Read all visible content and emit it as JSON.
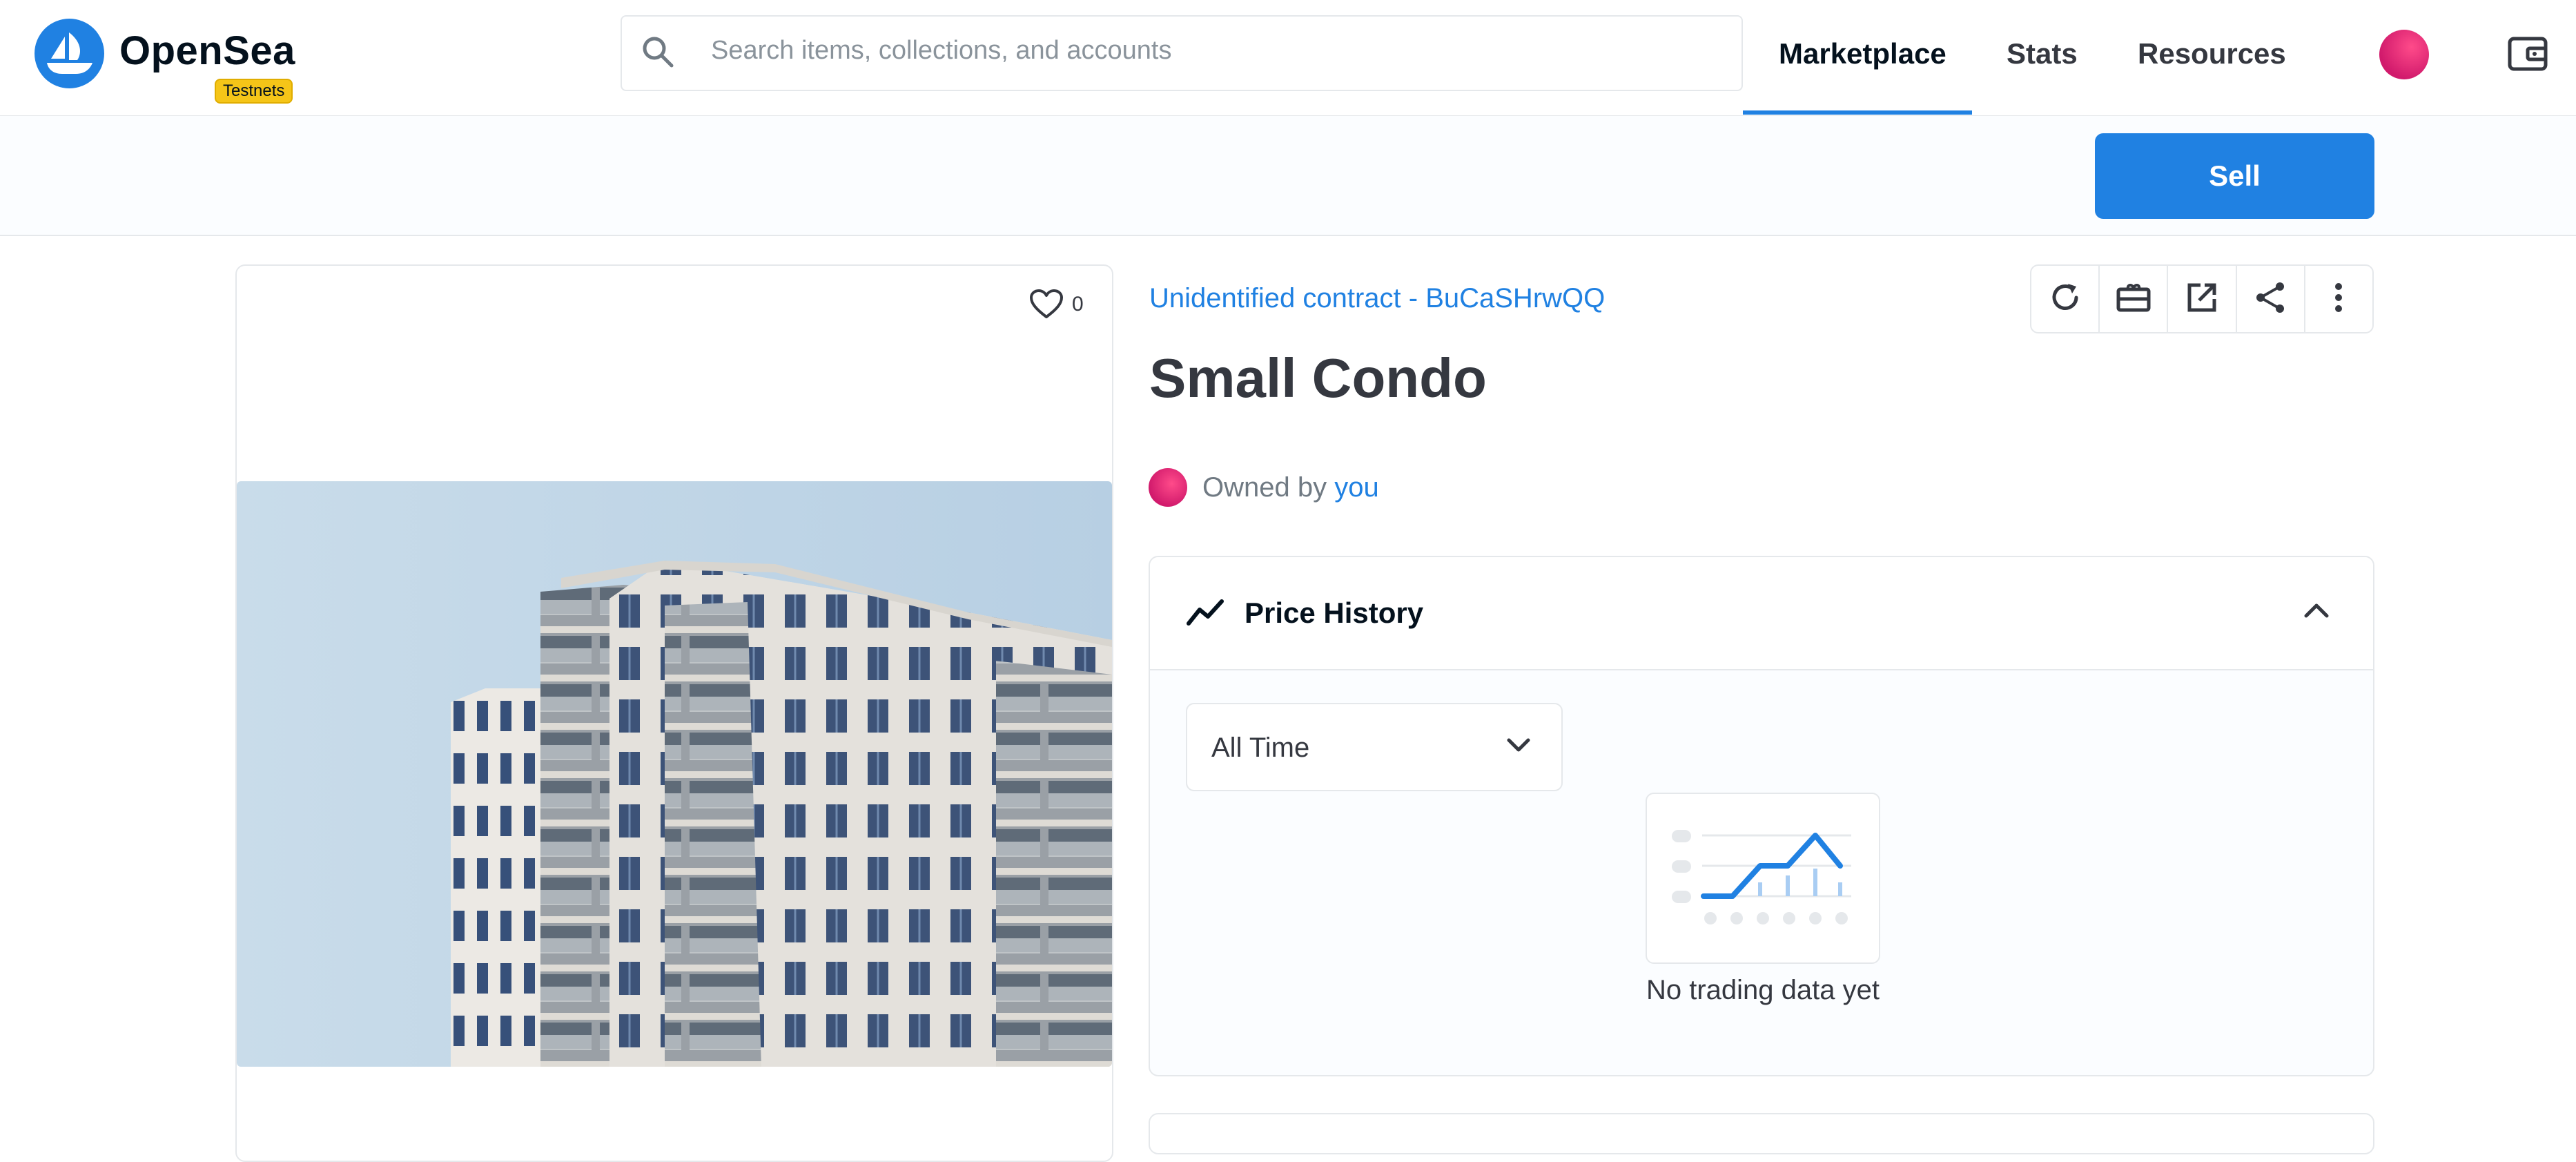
{
  "header": {
    "logo_text": "OpenSea",
    "badge": "Testnets",
    "search_placeholder": "Search items, collections, and accounts",
    "nav": [
      "Marketplace",
      "Stats",
      "Resources"
    ],
    "active_nav": "Marketplace"
  },
  "subbar": {
    "sell_label": "Sell"
  },
  "asset": {
    "like_count": "0",
    "collection": "Unidentified contract - BuCaSHrwQQ",
    "title": "Small Condo",
    "owned_prefix": "Owned by",
    "owner": "you"
  },
  "price_history": {
    "title": "Price History",
    "range_selected": "All Time",
    "empty_message": "No trading data yet"
  },
  "toolbar_icons": [
    "refresh-icon",
    "transfer-icon",
    "external-link-icon",
    "share-icon",
    "more-icon"
  ],
  "colors": {
    "brand": "#2081e2",
    "badge": "#f5c518",
    "avatar": "#e0237a"
  }
}
